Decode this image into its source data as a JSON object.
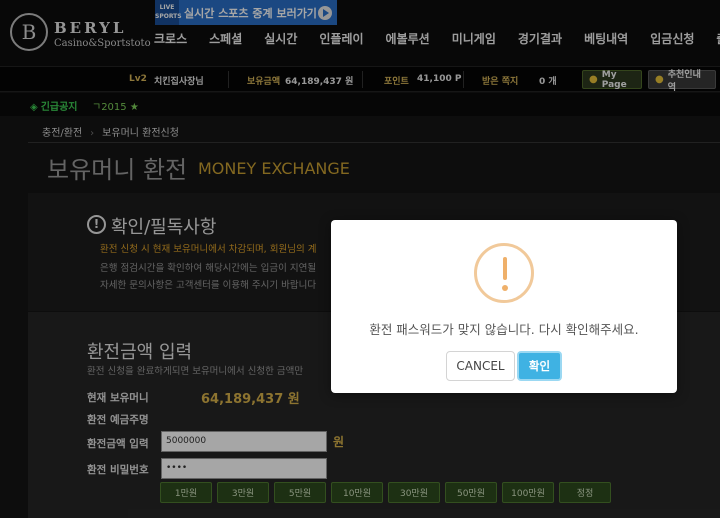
{
  "header": {
    "logo_mark": "B",
    "logo_name": "BERYL",
    "logo_sub": "Casino&Sportstoto",
    "banner": {
      "badge": "LIVE SPORTS",
      "text": "실시간 스포츠 중계 보러가기"
    },
    "nav": [
      "크로스",
      "스페셜",
      "실시간",
      "인플레이",
      "에볼루션",
      "미니게임",
      "경기결과",
      "베팅내역",
      "입금신청",
      "출금신청"
    ]
  },
  "userbar": {
    "level": "Lv2",
    "username": "치킨집사장님",
    "balance_label": "보유금액",
    "balance": "64,189,437 원",
    "points_label": "포인트",
    "points": "41,100 P",
    "notes_label": "받은 쪽지",
    "notes": "0 개",
    "mypage": "My Page",
    "recommend": "추천인내역"
  },
  "notice": {
    "label": "긴급공지",
    "text": "ㄱ2015 ★"
  },
  "breadcrumb": [
    "충전/환전",
    "보유머니 환전신청"
  ],
  "page": {
    "title": "보유머니 환전",
    "subtitle": "MONEY EXCHANGE"
  },
  "notice_box": {
    "title": "확인/필독사항",
    "line1": "환전 신청 시 현재 보유머니에서 차감되며, 회원님의 계",
    "line2": "은행 점검시간을 확인하여 해당시간에는 입금이 지연될",
    "line3": "자세한 문의사항은 고객센터를 이용해 주시기 바랍니다"
  },
  "form": {
    "title": "환전금액 입력",
    "desc": "환전 신청을 완료하게되면 보유머니에서 신청한 금액만",
    "balance_label": "현재 보유머니",
    "balance_value": "64,189,437 원",
    "holder_label": "환전 예금주명",
    "amount_label": "환전금액 입력",
    "amount_value": "5000000",
    "unit": "원",
    "password_label": "환전 비밀번호",
    "password_value": "••••",
    "amount_buttons": [
      "1만원",
      "3만원",
      "5만원",
      "10만원",
      "30만원",
      "50만원",
      "100만원",
      "정정"
    ]
  },
  "modal": {
    "message": "환전 패스워드가 맞지 않습니다. 다시 확인해주세요.",
    "cancel": "CANCEL",
    "confirm": "확인",
    "accent": "#3fb2e3",
    "warning_color": "#efb06a"
  }
}
